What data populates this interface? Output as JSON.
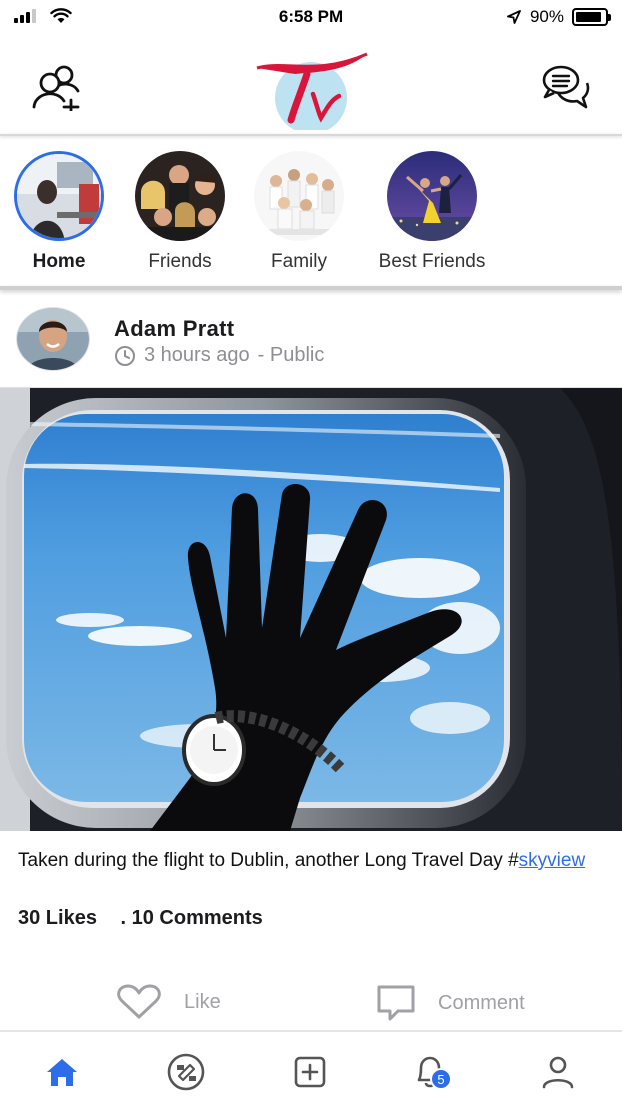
{
  "status_bar": {
    "time": "6:58 PM",
    "battery_percent": "90%",
    "battery_level": 0.9,
    "signal_bars": 3,
    "icons": [
      "signal-icon",
      "wifi-icon",
      "location-arrow-icon",
      "battery-icon"
    ]
  },
  "top_nav": {
    "left_icon": "add-friend-icon",
    "logo_text": "Tv",
    "right_icon": "chat-bubbles-icon"
  },
  "groups": [
    {
      "label": "Home",
      "active": true
    },
    {
      "label": "Friends",
      "active": false
    },
    {
      "label": "Family",
      "active": false
    },
    {
      "label": "Best Friends",
      "active": false
    }
  ],
  "post": {
    "author": "Adam Pratt",
    "time_ago": "3 hours ago",
    "visibility": "- Public",
    "caption_text": "Taken during the flight to Dublin, another Long Travel Day #",
    "hashtag": "skyview",
    "likes": "30 Likes",
    "comments": ". 10 Comments",
    "actions": {
      "like_label": "Like",
      "comment_label": "Comment"
    }
  },
  "tabbar": {
    "tabs": [
      "home-icon",
      "explore-icon",
      "add-post-icon",
      "notifications-icon",
      "profile-icon"
    ],
    "notification_count": "5",
    "active_tab": "home-icon"
  },
  "colors": {
    "accent": "#2d6ee8",
    "logo_red": "#d8163c",
    "logo_circle": "#bde3f2",
    "muted_text": "#8e8e93"
  }
}
